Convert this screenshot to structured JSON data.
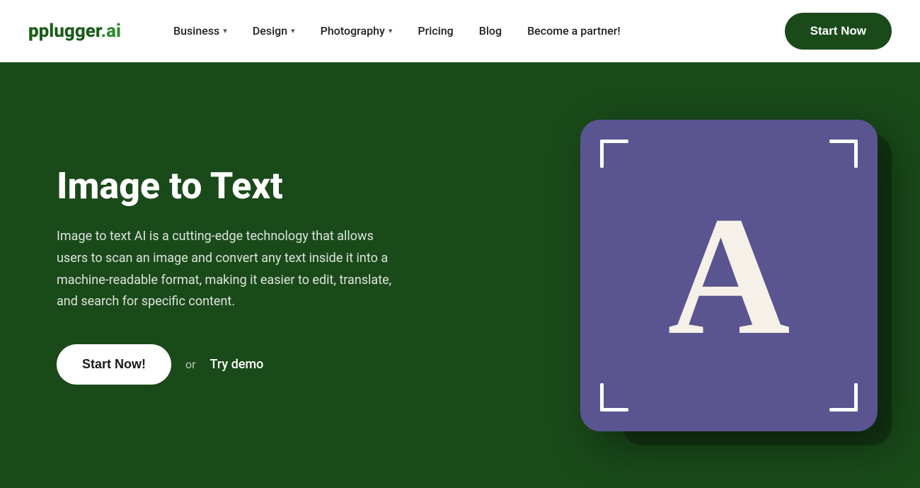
{
  "logo": {
    "text": "plugger.ai",
    "prefix": "plugger",
    "suffix": ".ai"
  },
  "nav": {
    "items": [
      {
        "label": "Business",
        "has_dropdown": true
      },
      {
        "label": "Design",
        "has_dropdown": true
      },
      {
        "label": "Photography",
        "has_dropdown": true
      },
      {
        "label": "Pricing",
        "has_dropdown": false
      },
      {
        "label": "Blog",
        "has_dropdown": false
      },
      {
        "label": "Become a partner!",
        "has_dropdown": false
      }
    ],
    "cta_label": "Start Now"
  },
  "hero": {
    "title": "Image to Text",
    "description": "Image to text AI is a cutting-edge technology that allows users to scan an image and convert any text inside it into a machine-readable format, making it easier to edit, translate, and search for specific content.",
    "start_button": "Start Now!",
    "or_text": "or",
    "try_demo_text": "Try demo",
    "card_letter": "A"
  }
}
